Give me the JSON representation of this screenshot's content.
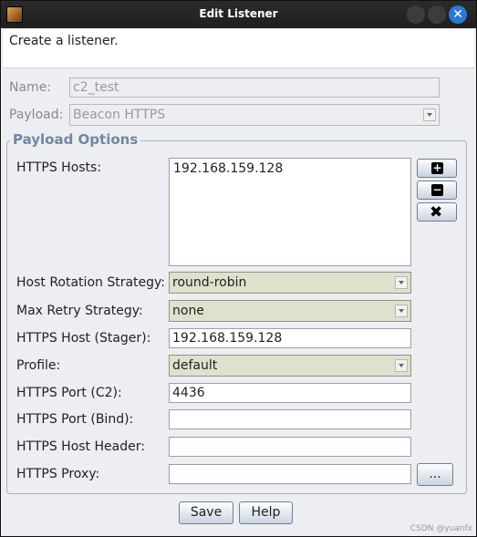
{
  "window": {
    "title": "Edit Listener",
    "close_symbol": "✕"
  },
  "description": "Create a listener.",
  "name": {
    "label": "Name:",
    "value": "c2_test"
  },
  "payload": {
    "label": "Payload:",
    "value": "Beacon HTTPS"
  },
  "group_title": "Payload Options",
  "https_hosts": {
    "label": "HTTPS Hosts:",
    "items": [
      "192.168.159.128"
    ]
  },
  "host_buttons": {
    "add": "+",
    "remove": "−",
    "clear": "✖"
  },
  "host_rotation": {
    "label": "Host Rotation Strategy:",
    "value": "round-robin"
  },
  "max_retry": {
    "label": "Max Retry Strategy:",
    "value": "none"
  },
  "stager_host": {
    "label": "HTTPS Host (Stager):",
    "value": "192.168.159.128"
  },
  "profile": {
    "label": "Profile:",
    "value": "default"
  },
  "port_c2": {
    "label": "HTTPS Port (C2):",
    "value": "4436"
  },
  "port_bind": {
    "label": "HTTPS Port (Bind):",
    "value": ""
  },
  "host_header": {
    "label": "HTTPS Host Header:",
    "value": ""
  },
  "proxy": {
    "label": "HTTPS Proxy:",
    "value": "",
    "button": "..."
  },
  "buttons": {
    "save": "Save",
    "help": "Help"
  },
  "watermark": "CSDN @yuanfx"
}
